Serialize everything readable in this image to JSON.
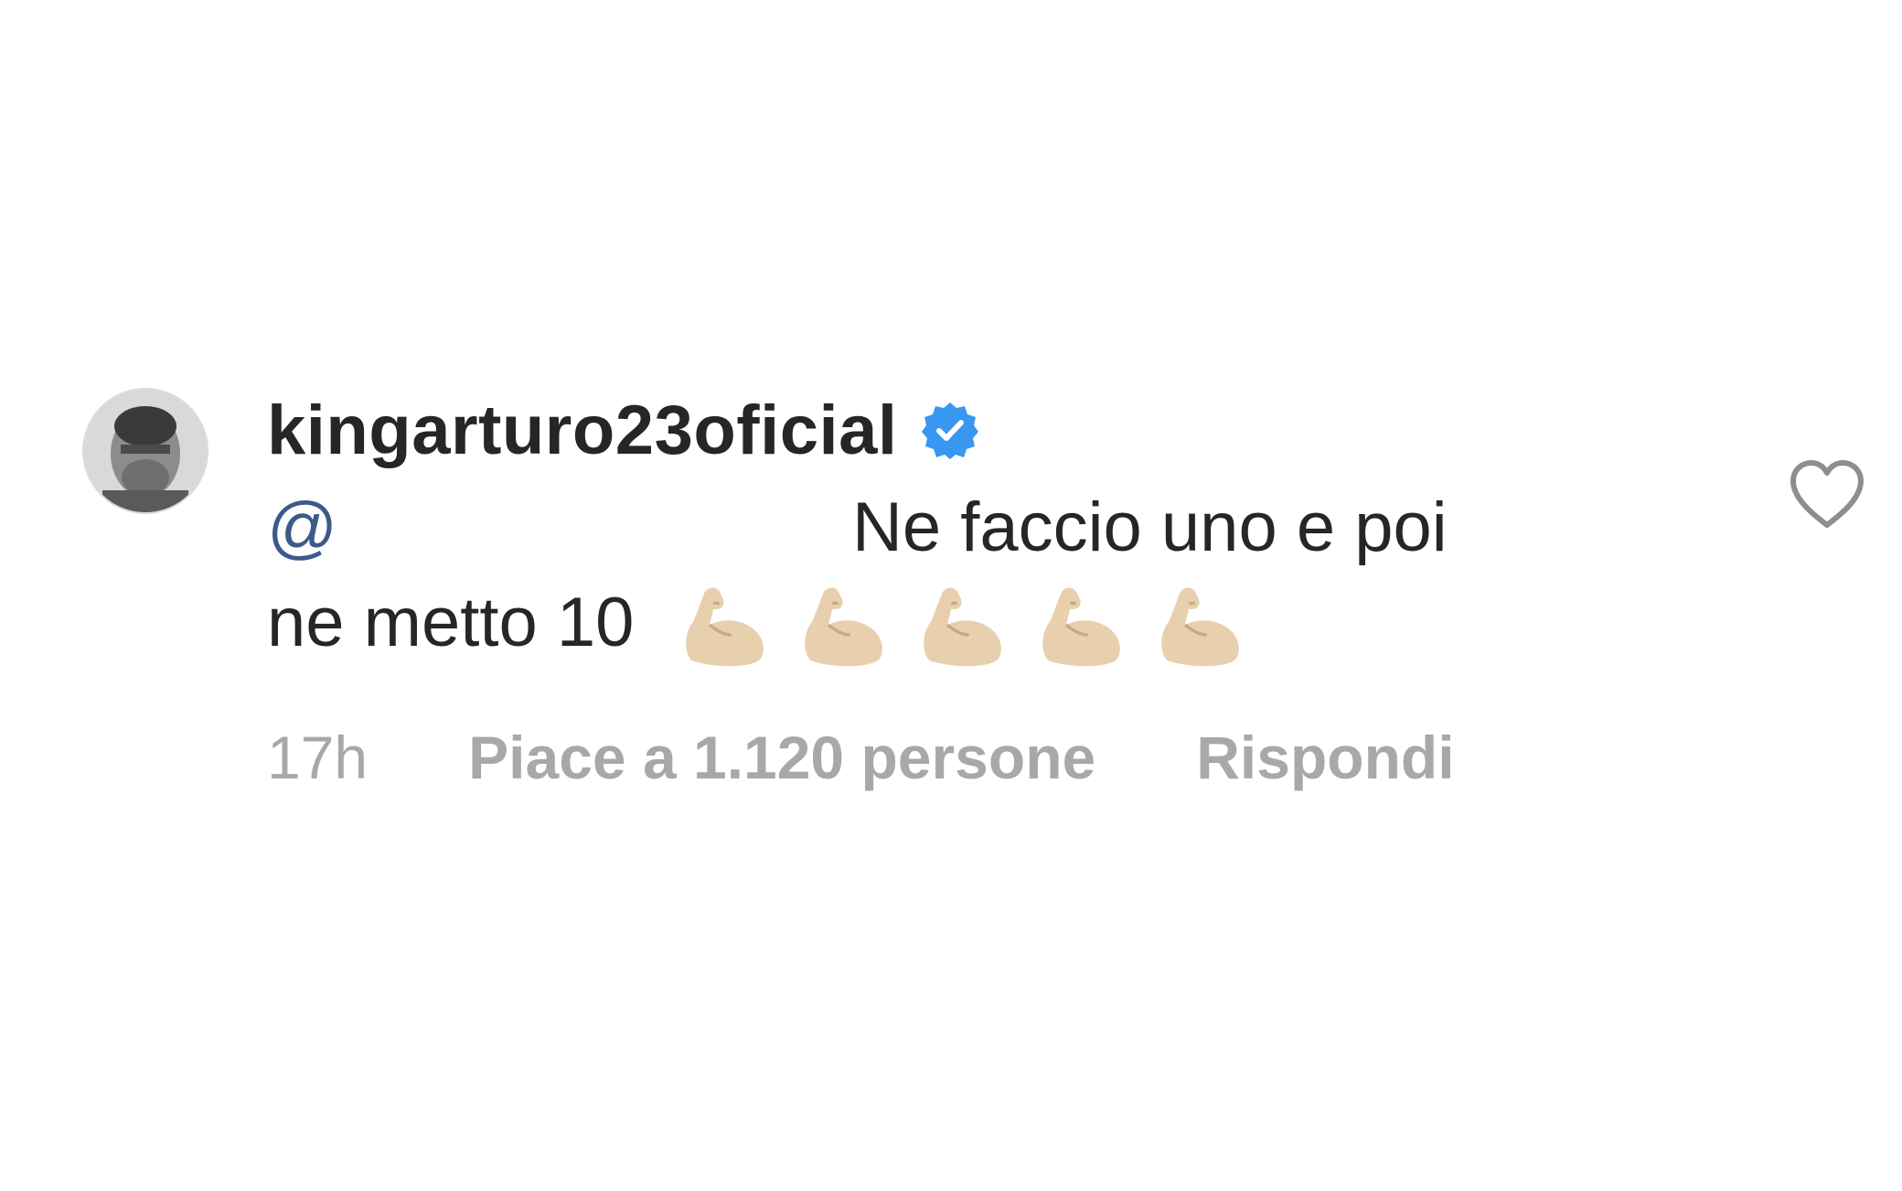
{
  "comment": {
    "username": "kingarturo23oficial",
    "verified": true,
    "mention_prefix": "@",
    "text_line1": "Ne faccio uno e poi",
    "text_line2": "ne metto 10",
    "emojis": [
      "flexed-biceps",
      "flexed-biceps",
      "flexed-biceps",
      "flexed-biceps",
      "flexed-biceps"
    ],
    "time": "17h",
    "likes": "Piace a 1.120 persone",
    "reply": "Rispondi"
  },
  "colors": {
    "text": "#262626",
    "meta": "#a8a8a8",
    "verified": "#3897f0",
    "mention": "#3a5a8a",
    "emoji_skin": "#e8cfae"
  }
}
